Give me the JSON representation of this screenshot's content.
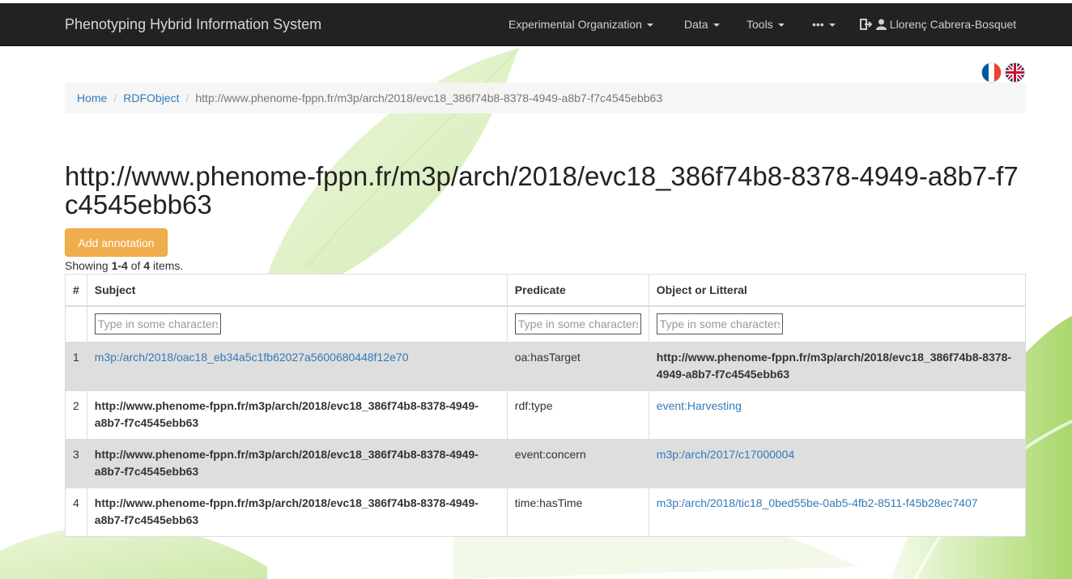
{
  "navbar": {
    "brand": "Phenotyping Hybrid Information System",
    "items": [
      {
        "label": "Experimental Organization"
      },
      {
        "label": "Data"
      },
      {
        "label": "Tools"
      },
      {
        "label": "•••"
      }
    ],
    "user": "Llorenç Cabrera-Bosquet"
  },
  "breadcrumb": {
    "home": "Home",
    "section": "RDFObject",
    "current": "http://www.phenome-fppn.fr/m3p/arch/2018/evc18_386f74b8-8378-4949-a8b7-f7c4545ebb63"
  },
  "page": {
    "title": "http://www.phenome-fppn.fr/m3p/arch/2018/evc18_386f74b8-8378-4949-a8b7-f7c4545ebb63",
    "add_annotation": "Add annotation",
    "summary": {
      "prefix": "Showing ",
      "range": "1-4",
      "of": " of ",
      "total": "4",
      "suffix": " items."
    }
  },
  "table": {
    "headers": {
      "num": "#",
      "subject": "Subject",
      "predicate": "Predicate",
      "object": "Object or Litteral"
    },
    "filter_placeholder": "Type in some characters",
    "rows": [
      {
        "num": "1",
        "subject": "m3p:/arch/2018/oac18_eb34a5c1fb62027a5600680448f12e70",
        "predicate": "oa:hasTarget",
        "object": "http://www.phenome-fppn.fr/m3p/arch/2018/evc18_386f74b8-8378-4949-a8b7-f7c4545ebb63"
      },
      {
        "num": "2",
        "subject": "http://www.phenome-fppn.fr/m3p/arch/2018/evc18_386f74b8-8378-4949-a8b7-f7c4545ebb63",
        "predicate": "rdf:type",
        "object": "event:Harvesting"
      },
      {
        "num": "3",
        "subject": "http://www.phenome-fppn.fr/m3p/arch/2018/evc18_386f74b8-8378-4949-a8b7-f7c4545ebb63",
        "predicate": "event:concern",
        "object": "m3p:/arch/2017/c17000004"
      },
      {
        "num": "4",
        "subject": "http://www.phenome-fppn.fr/m3p/arch/2018/evc18_386f74b8-8378-4949-a8b7-f7c4545ebb63",
        "predicate": "time:hasTime",
        "object": "m3p:/arch/2018/tic18_0bed55be-0ab5-4fb2-8511-f45b28ec7407"
      }
    ]
  },
  "colors": {
    "navbar_bg": "#222222",
    "link": "#337ab7",
    "warning_button": "#f0ad4e",
    "striped_row": "#dedede",
    "leaf_green": "#8bc34a"
  }
}
